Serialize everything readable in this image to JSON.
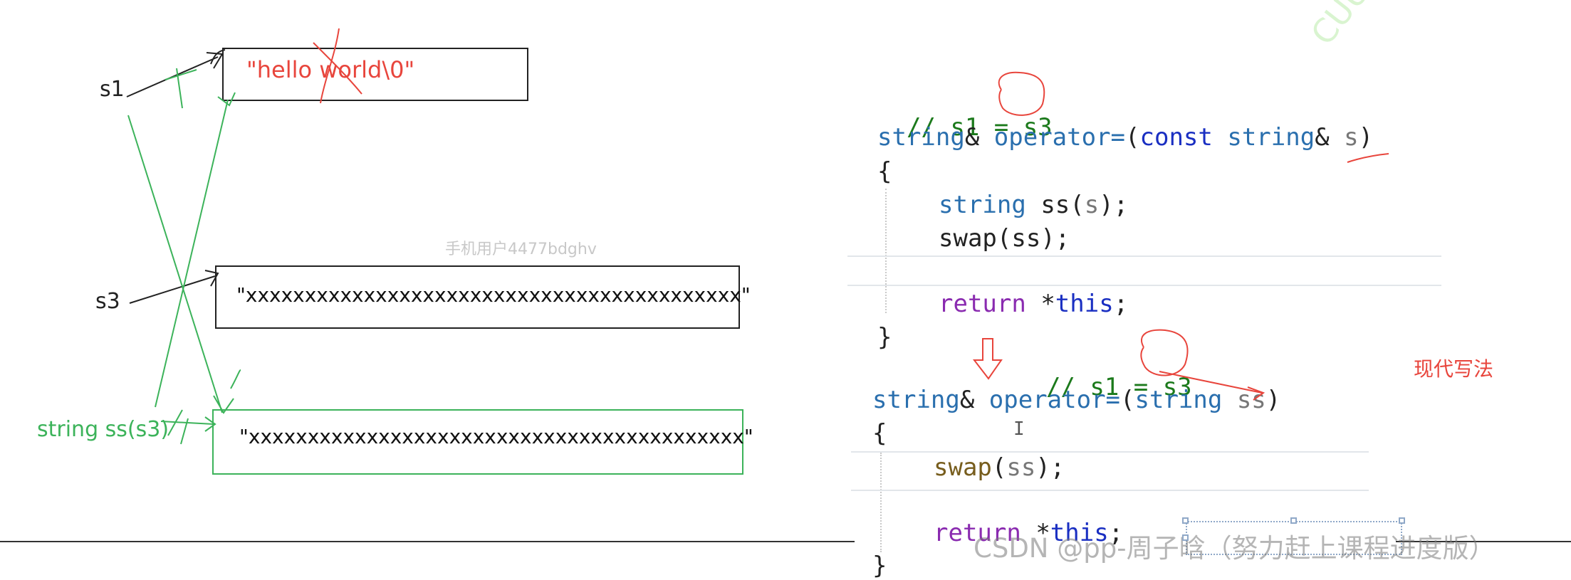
{
  "diagram": {
    "labels": {
      "s1": "s1",
      "s3": "s3",
      "ss": "string ss(s3)"
    },
    "boxes": {
      "s1_value": "\"hello world\\0\"",
      "s3_value": "\"xxxxxxxxxxxxxxxxxxxxxxxxxxxxxxxxxxxxxxxxxx\"",
      "ss_value": "\"xxxxxxxxxxxxxxxxxxxxxxxxxxxxxxxxxxxxxxxxxx\""
    },
    "watermark_user": "手机用户4477bdghv"
  },
  "code": {
    "block1": {
      "comment": "// s1 = s3",
      "sig_type": "string",
      "sig_amp": "&",
      "sig_op": "operator=",
      "sig_open": "(",
      "sig_const": "const",
      "sig_ptype": "string",
      "sig_pamp": "&",
      "sig_param": "s",
      "sig_close": ")",
      "open_brace": "{",
      "l1_type": "string",
      "l1_rest_a": "ss(",
      "l1_param": "s",
      "l1_rest_b": ");",
      "l2": "swap(ss);",
      "ret": "return",
      "ret_star": "*",
      "ret_this": "this",
      "ret_end": ";",
      "close_brace": "}"
    },
    "block2": {
      "comment": "// s1 = s3",
      "sig_type": "string",
      "sig_amp": "&",
      "sig_op": "operator=",
      "sig_open": "(",
      "sig_ptype": "string",
      "sig_param": "ss",
      "sig_close": ")",
      "open_brace": "{",
      "l1_fn": "swap",
      "l1_open": "(",
      "l1_arg": "ss",
      "l1_close": ");",
      "ret": "return",
      "ret_star": "*",
      "ret_this": "this",
      "ret_end": ";",
      "close_brace": "}"
    },
    "annotation_modern": "现代写法",
    "down_arrow": "⇩",
    "cursor": "I"
  },
  "footer_watermark": "CSDN @pp-周子晗（努力赶上课程进度版）",
  "corner_watermark": "CUUS",
  "colors": {
    "red": "#e8453c",
    "green": "#3cb35a",
    "keyword": "#2a6fae",
    "comment": "#1c7a1c",
    "return": "#8a2bb0",
    "this": "#1a2fc2"
  }
}
